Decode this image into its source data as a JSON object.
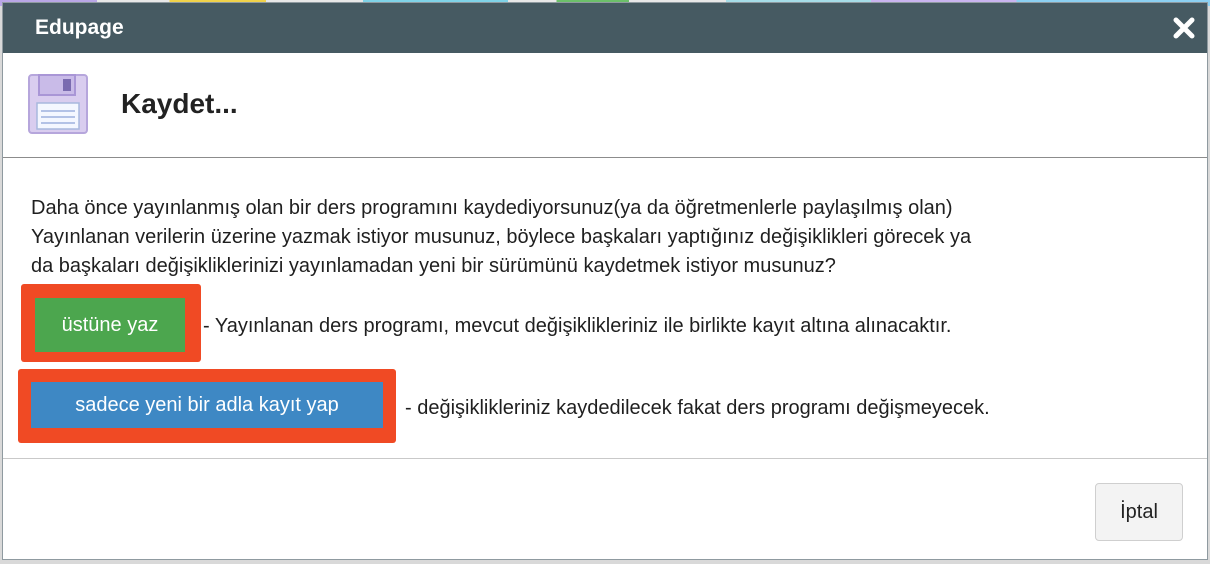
{
  "window": {
    "title": "Edupage",
    "close_icon": "close-icon"
  },
  "header": {
    "icon": "floppy-disk-icon",
    "title": "Kaydet..."
  },
  "body": {
    "message_line1": "Daha önce yayınlanmış olan bir ders programını kaydediyorsunuz(ya da öğretmenlerle paylaşılmış olan)",
    "message_line2": "Yayınlanan verilerin üzerine yazmak istiyor musunuz, böylece başkaları yaptığınız değişiklikleri görecek ya",
    "message_line3": "da başkaları değişikliklerinizi yayınlamadan yeni bir sürümünü kaydetmek istiyor musunuz?",
    "overwrite_button": "üstüne yaz",
    "overwrite_desc": "- Yayınlanan ders programı, mevcut değişiklikleriniz ile birlikte kayıt altına alınacaktır.",
    "save_new_button": "sadece yeni bir adla kayıt yap",
    "save_new_desc": "- değişiklikleriniz kaydedilecek fakat ders programı değişmeyecek."
  },
  "footer": {
    "cancel_button": "İptal"
  },
  "colors": {
    "titlebar": "#465a62",
    "overwrite_button": "#4ca64e",
    "save_new_button": "#3e88c4",
    "highlight": "#f04a24"
  }
}
